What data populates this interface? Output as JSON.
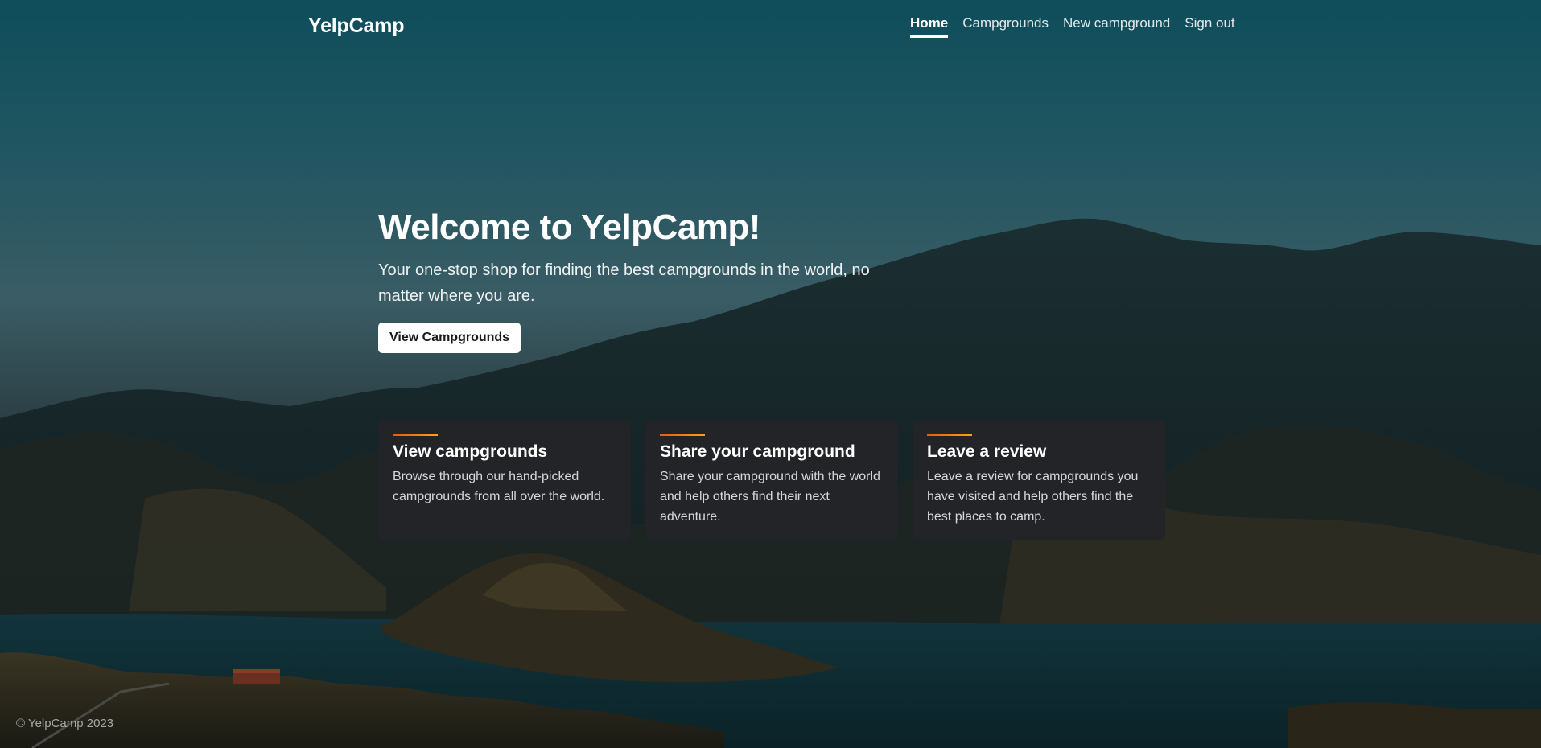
{
  "brand": "YelpCamp",
  "nav": {
    "items": [
      {
        "label": "Home",
        "active": true
      },
      {
        "label": "Campgrounds",
        "active": false
      },
      {
        "label": "New campground",
        "active": false
      },
      {
        "label": "Sign out",
        "active": false
      }
    ]
  },
  "hero": {
    "title": "Welcome to YelpCamp!",
    "subtitle": "Your one-stop shop for finding the best campgrounds in the world, no matter where you are.",
    "button_label": "View Campgrounds"
  },
  "cards": [
    {
      "title": "View campgrounds",
      "text": "Browse through our hand-picked campgrounds from all over the world."
    },
    {
      "title": "Share your campground",
      "text": "Share your campground with the world and help others find their next adventure."
    },
    {
      "title": "Leave a review",
      "text": "Leave a review for campgrounds you have visited and help others find the best places to camp."
    }
  ],
  "footer": "© YelpCamp 2023",
  "colors": {
    "accent_start": "#e25b1a",
    "accent_end": "#f2a51c",
    "card_bg": "#232428",
    "button_bg": "#ffffff"
  }
}
